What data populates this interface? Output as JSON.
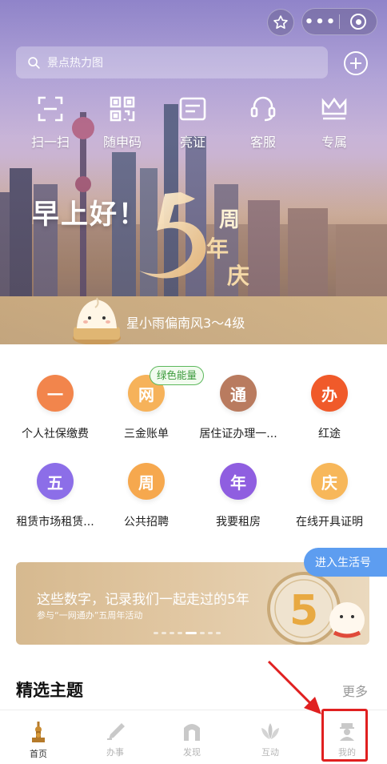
{
  "header": {
    "search_placeholder": "景点热力图"
  },
  "quick_actions": [
    {
      "label": "扫一扫",
      "icon": "scan-icon"
    },
    {
      "label": "随申码",
      "icon": "qr-code-icon"
    },
    {
      "label": "亮证",
      "icon": "id-card-icon"
    },
    {
      "label": "客服",
      "icon": "headset-icon"
    },
    {
      "label": "专属",
      "icon": "crown-icon"
    }
  ],
  "hero": {
    "greeting": "早上好！",
    "weather": "星小雨偏南风3～4级"
  },
  "services": [
    {
      "glyph": "一",
      "label": "个人社保缴费",
      "color": "#f2854c"
    },
    {
      "glyph": "网",
      "label": "三金账单",
      "color": "#f6b25a"
    },
    {
      "glyph": "通",
      "label": "居住证办理一...",
      "color": "#b97b5f"
    },
    {
      "glyph": "办",
      "label": "红途",
      "color": "#f05a2a"
    },
    {
      "glyph": "五",
      "label": "租赁市场租赁...",
      "color": "#8c6ee8"
    },
    {
      "glyph": "周",
      "label": "公共招聘",
      "color": "#f6a84e"
    },
    {
      "glyph": "年",
      "label": "我要租房",
      "color": "#8f5ee0"
    },
    {
      "glyph": "庆",
      "label": "在线开具证明",
      "color": "#f7b75a"
    }
  ],
  "badge": "绿色能量",
  "life_button": "进入生活号",
  "banner": {
    "title": "这些数字，记录我们一起走过的5年",
    "subtitle": "参与“一网通办”五周年活动"
  },
  "section": {
    "title": "精选主题",
    "more": "更多"
  },
  "tabs": [
    {
      "label": "首页",
      "icon": "home-icon",
      "active": true
    },
    {
      "label": "办事",
      "icon": "pen-icon",
      "active": false
    },
    {
      "label": "发现",
      "icon": "arch-icon",
      "active": false
    },
    {
      "label": "互动",
      "icon": "lotus-icon",
      "active": false
    },
    {
      "label": "我的",
      "icon": "profile-icon",
      "active": false
    }
  ]
}
